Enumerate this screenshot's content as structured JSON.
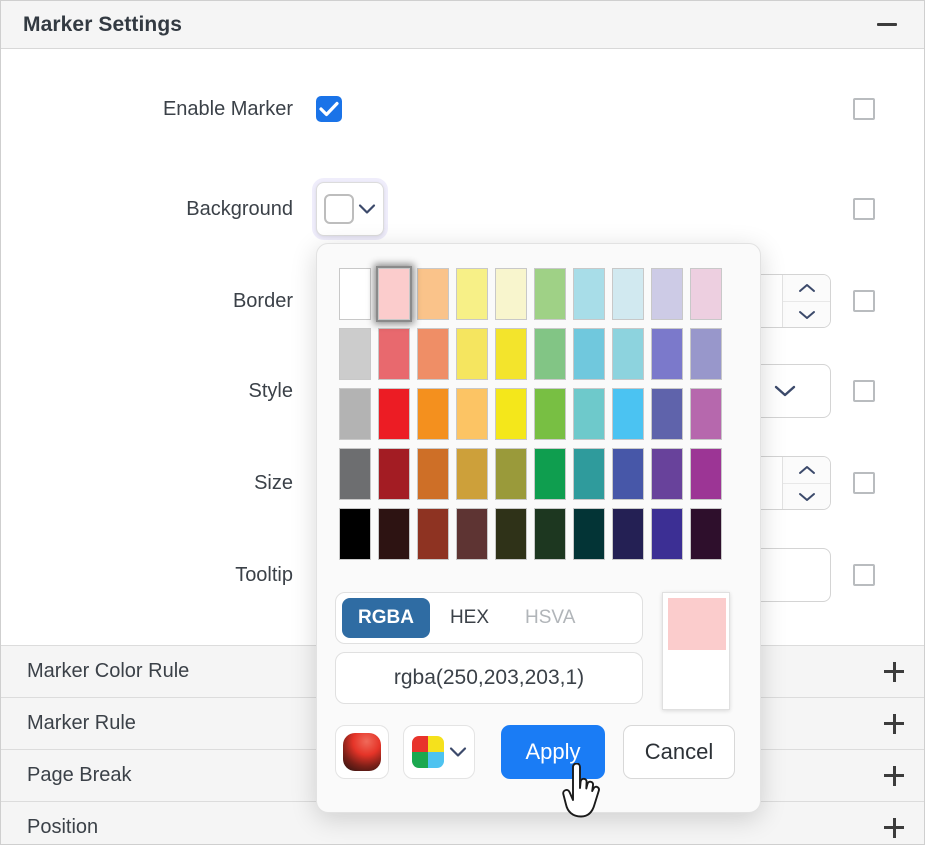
{
  "header": {
    "title": "Marker Settings",
    "collapse_icon": "minus-icon"
  },
  "form": {
    "rows": [
      {
        "label": "Enable Marker",
        "control": "checkbox-checked",
        "checkbox": false
      },
      {
        "label": "Background",
        "control": "color-swatch",
        "checkbox": false
      },
      {
        "label": "Border",
        "control": "number-spinner",
        "value": "",
        "checkbox": false
      },
      {
        "label": "Style",
        "control": "select",
        "value": "",
        "checkbox": false
      },
      {
        "label": "Size",
        "control": "number-spinner",
        "value": "",
        "checkbox": false
      },
      {
        "label": "Tooltip",
        "control": "textbox",
        "value": "",
        "checkbox": false
      }
    ]
  },
  "accordion": {
    "expand_icon": "plus-icon",
    "items": [
      {
        "label": "Marker Color Rule"
      },
      {
        "label": "Marker Rule"
      },
      {
        "label": "Page Break"
      },
      {
        "label": "Position"
      }
    ]
  },
  "color_picker": {
    "selected_index": 1,
    "selected_color": "#fbcccc",
    "previous_color": "#ffffff",
    "value_text": "rgba(250,203,203,1)",
    "format_tabs": [
      {
        "label": "RGBA",
        "state": "active"
      },
      {
        "label": "HEX",
        "state": "normal"
      },
      {
        "label": "HSVA",
        "state": "disabled"
      }
    ],
    "buttons": {
      "apply": "Apply",
      "cancel": "Cancel",
      "gradient_icon": "gradient-swatch-icon",
      "palette_icon": "palette-quad-icon",
      "palette_chevron_icon": "chevron-down-icon"
    },
    "palette_colors": [
      "#ffffff",
      "#fbcccc",
      "#fac38a",
      "#f7f087",
      "#f8f5cd",
      "#9fd186",
      "#a8dde8",
      "#d1e9f0",
      "#cdcbe6",
      "#edcfe0",
      "#cccccc",
      "#e8696e",
      "#ef8e66",
      "#f5e55f",
      "#f3e42c",
      "#82c585",
      "#70c8dd",
      "#8dd3de",
      "#7b79cb",
      "#9897cb",
      "#b3b3b3",
      "#ec1c24",
      "#f4901e",
      "#fcc464",
      "#f4e71b",
      "#78bf43",
      "#6ec9cb",
      "#4bc3f2",
      "#5f63ab",
      "#b668ad",
      "#6d6e70",
      "#a31c23",
      "#ce6f27",
      "#cda03a",
      "#9a9a3a",
      "#0f9e4f",
      "#2f9b9c",
      "#4757a8",
      "#68429b",
      "#9c3595",
      "#000000",
      "#2d1312",
      "#8e3322",
      "#5e3433",
      "#2f3218",
      "#1d3720",
      "#033436",
      "#242054",
      "#3c2f94",
      "#2e0f2c"
    ],
    "palette_rows": 5,
    "palette_cols": 10
  },
  "colors": {
    "accent_blue": "#1a7cf5",
    "tab_active_blue": "#2f6ca3",
    "checkbox_blue": "#1a73e8",
    "header_bg": "#f5f5f5",
    "text": "#3b4148"
  },
  "cursor": {
    "icon": "pointing-hand-cursor"
  }
}
